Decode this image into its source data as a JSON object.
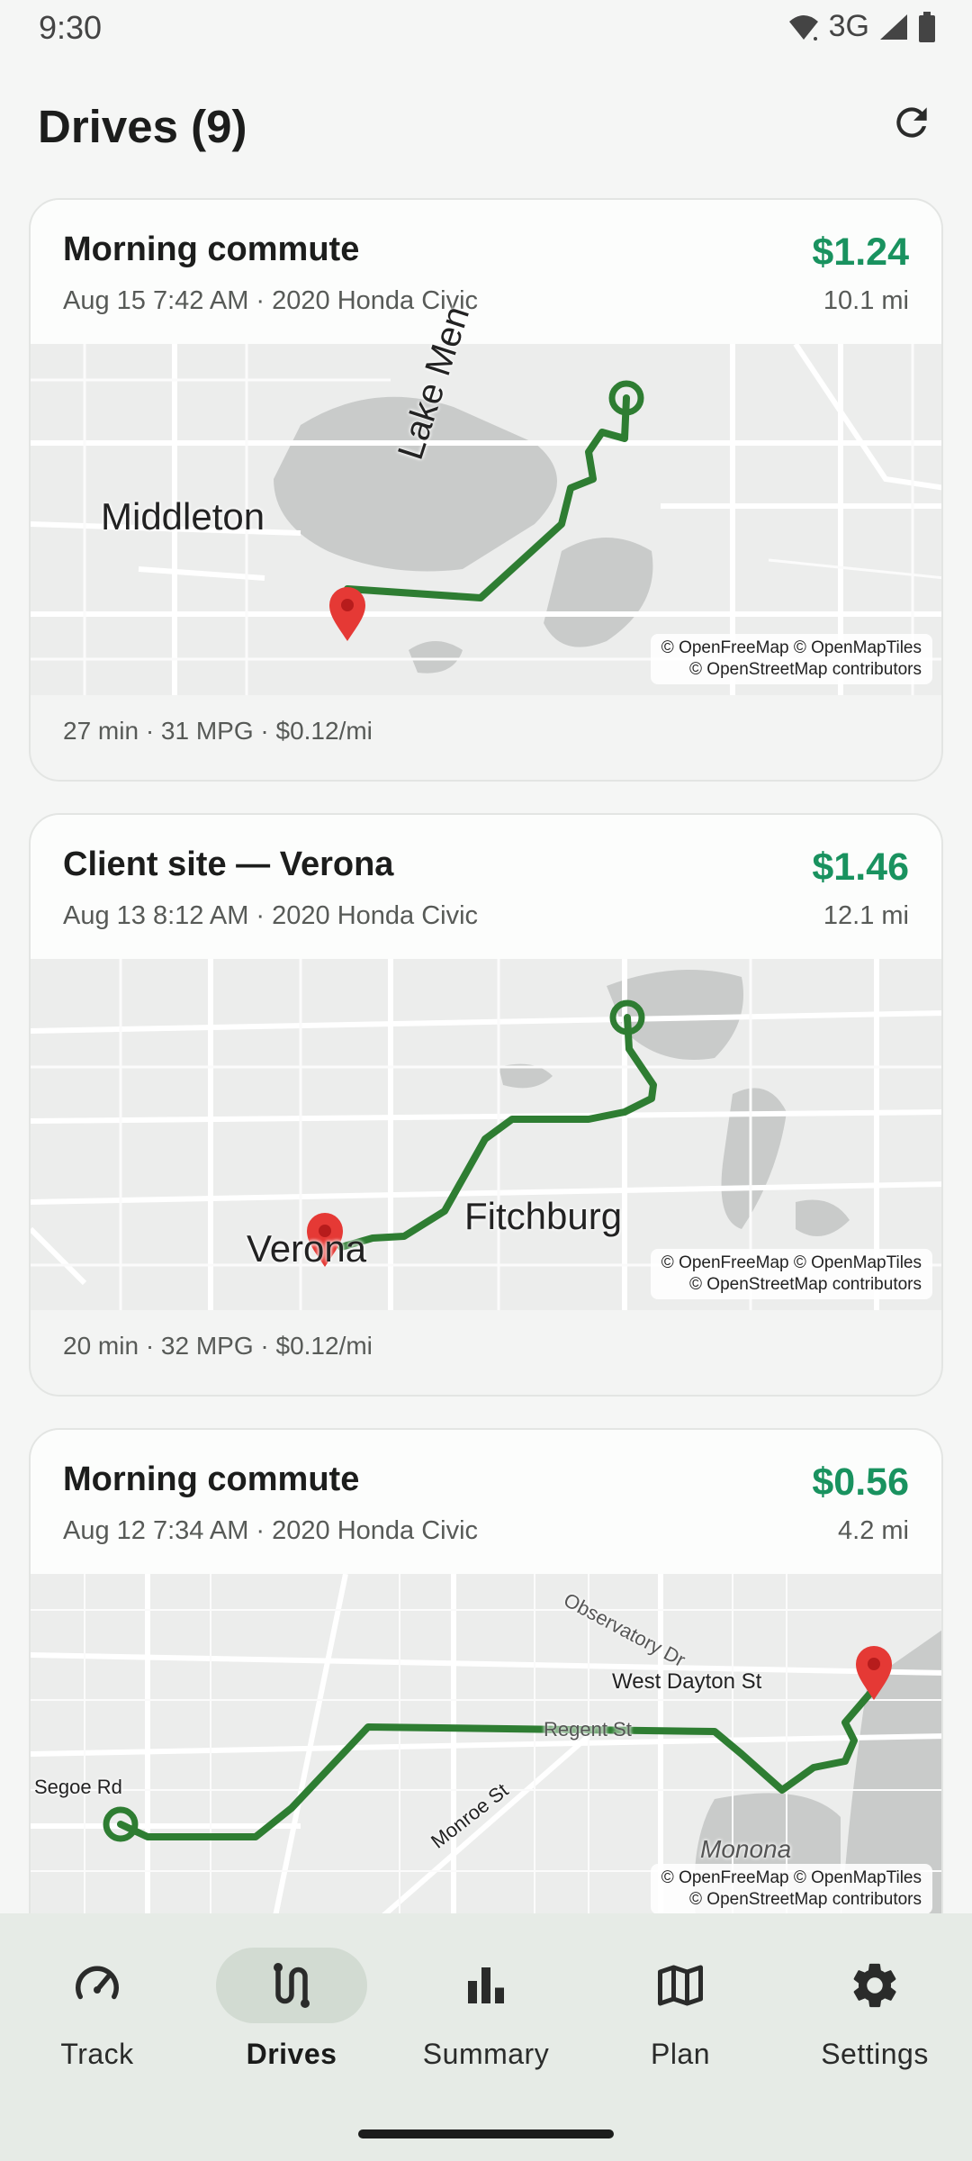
{
  "status": {
    "time": "9:30",
    "network": "3G"
  },
  "header": {
    "title": "Drives (9)"
  },
  "drives": [
    {
      "title": "Morning commute",
      "meta": "Aug 15 7:42 AM · 2020 Honda Civic",
      "cost": "$1.24",
      "distance": "10.1 mi",
      "footer": "27 min · 31 MPG · $0.12/mi",
      "map_labels": [
        "Middleton",
        "Lake Men"
      ],
      "attribution": [
        "© OpenFreeMap © OpenMapTiles",
        "© OpenStreetMap contributors"
      ]
    },
    {
      "title": "Client site — Verona",
      "meta": "Aug 13 8:12 AM · 2020 Honda Civic",
      "cost": "$1.46",
      "distance": "12.1 mi",
      "footer": "20 min · 32 MPG · $0.12/mi",
      "map_labels": [
        "Verona",
        "Fitchburg"
      ],
      "attribution": [
        "© OpenFreeMap © OpenMapTiles",
        "© OpenStreetMap contributors"
      ]
    },
    {
      "title": "Morning commute",
      "meta": "Aug 12 7:34 AM · 2020 Honda Civic",
      "cost": "$0.56",
      "distance": "4.2 mi",
      "map_labels": [
        "West Dayton St",
        "Regent St",
        "Monroe St",
        "Monona",
        "Observatory Dr",
        "Segoe Rd"
      ],
      "attribution": [
        "© OpenFreeMap © OpenMapTiles",
        "© OpenStreetMap contributors"
      ]
    }
  ],
  "nav": [
    {
      "label": "Track"
    },
    {
      "label": "Drives",
      "active": true
    },
    {
      "label": "Summary"
    },
    {
      "label": "Plan"
    },
    {
      "label": "Settings"
    }
  ],
  "colors": {
    "route": "#2e7d32",
    "cost": "#19925f",
    "pin": "#e53935"
  }
}
